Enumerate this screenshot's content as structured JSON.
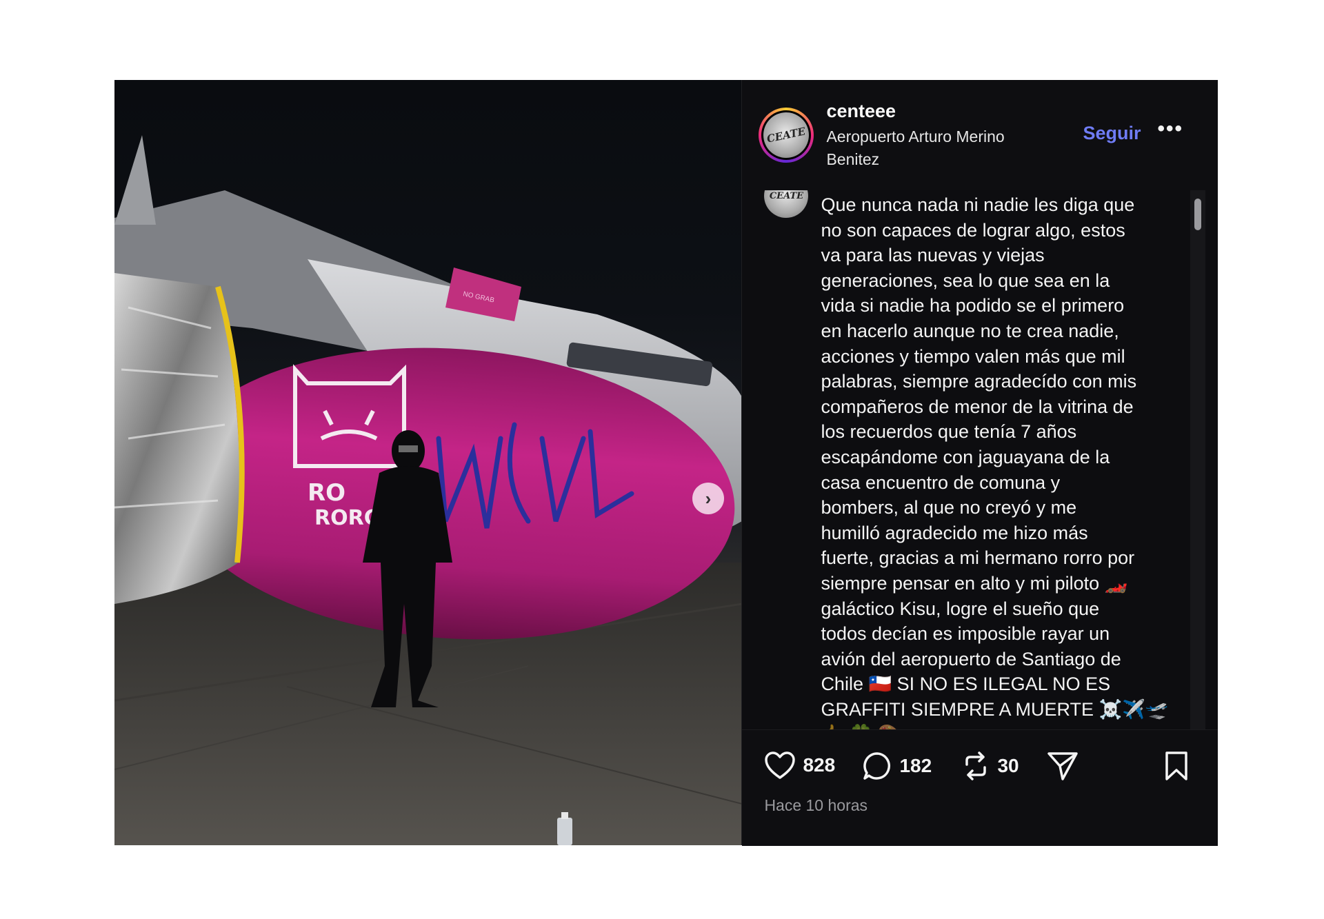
{
  "post": {
    "username": "centeee",
    "location": "Aeropuerto Arturo Merino Benitez",
    "follow_label": "Seguir",
    "more_label": "•••",
    "avatar_text": "CEATE",
    "caption_lines": [
      "Que nunca nada ni nadie les diga que",
      "no son capaces de lograr algo, estos",
      "va para las nuevas y viejas",
      "generaciones, sea lo que sea en la",
      "vida si nadie ha podido se el primero",
      "en hacerlo aunque no te crea nadie,",
      "acciones y tiempo valen más que mil",
      "palabras, siempre agradecído con mis",
      "compañeros de menor de la vitrina de",
      "los recuerdos  que tenía 7 años",
      "escapándome con jaguayana de la",
      "casa encuentro de comuna y",
      "bombers, al que no creyó y me",
      "humilló agradecido me hizo más",
      "fuerte, gracias a mi hermano rorro por",
      "siempre pensar en alto y mi piloto 🏎️",
      "galáctico Kisu, logre el sueño que",
      "todos decían es imposible rayar un",
      "avión del aeropuerto de Santiago de",
      "Chile 🇨🇱 SI NO ES ILEGAL NO ES",
      "GRAFFITI SIEMPRE A MUERTE ☠️✈️🛫",
      "🤙 🍀 🎨 ..."
    ],
    "likes": "828",
    "comments": "182",
    "reposts": "30",
    "timestamp": "Hace 10 horas"
  },
  "photo": {
    "next_label": "›",
    "graffiti_sticker_text": "NO GRAB",
    "graffiti_left_text_1": "RO",
    "graffiti_left_text_2": "RORC"
  },
  "colors": {
    "engine_magenta": "#b5207a",
    "follow_blue": "#6f7cf5",
    "panel_bg": "#0d0d10"
  },
  "icons": {
    "like": "heart-icon",
    "comment": "comment-icon",
    "repost": "repost-icon",
    "share": "send-icon",
    "save": "bookmark-icon",
    "next": "chevron-right-icon"
  }
}
